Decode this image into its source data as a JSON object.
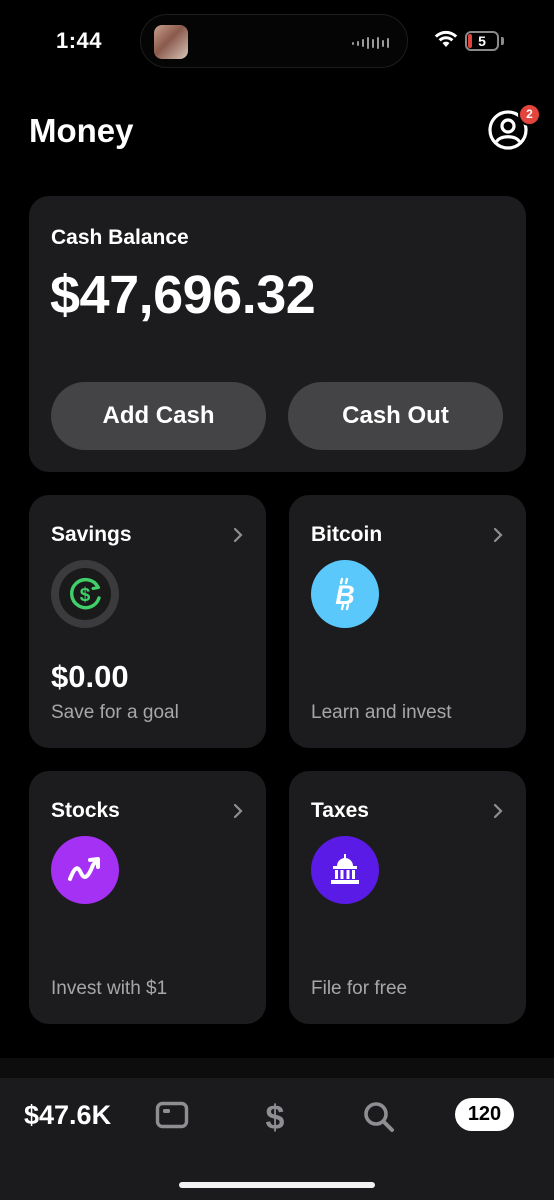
{
  "status_bar": {
    "time": "1:44",
    "battery_level": "5"
  },
  "header": {
    "title": "Money",
    "notification_count": "2"
  },
  "balance_card": {
    "label": "Cash Balance",
    "amount": "$47,696.32",
    "add_cash_label": "Add Cash",
    "cash_out_label": "Cash Out"
  },
  "tiles": {
    "savings": {
      "title": "Savings",
      "value": "$0.00",
      "subtitle": "Save for a goal",
      "icon": "savings-dollar-icon",
      "color": "#3fd06a"
    },
    "bitcoin": {
      "title": "Bitcoin",
      "subtitle": "Learn and invest",
      "icon": "bitcoin-icon",
      "color": "#5ac8fa"
    },
    "stocks": {
      "title": "Stocks",
      "subtitle": "Invest with $1",
      "icon": "stocks-trend-icon",
      "color": "#a431f4"
    },
    "taxes": {
      "title": "Taxes",
      "subtitle": "File for free",
      "icon": "capitol-building-icon",
      "color": "#5b1be6"
    }
  },
  "bottom_nav": {
    "balance": "$47.6K",
    "items": [
      {
        "icon": "card-icon"
      },
      {
        "icon": "dollar-icon"
      },
      {
        "icon": "search-icon"
      }
    ],
    "activity_count": "120"
  }
}
